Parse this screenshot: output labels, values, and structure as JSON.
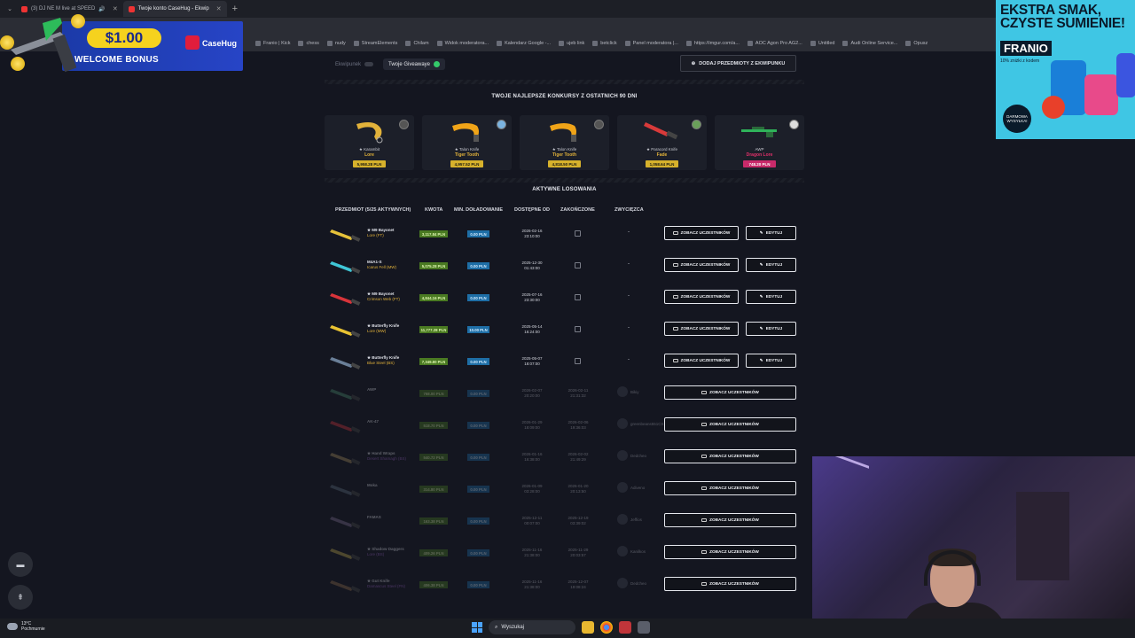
{
  "browser": {
    "tabs": [
      {
        "label": "(3) DJ NE M live at SPEED",
        "active": false
      },
      {
        "label": "Twoje konto CaseHug - Ekwip",
        "active": true
      }
    ],
    "bookmarks": [
      "Franio | Kick",
      "chess",
      "nudy",
      "StreamElements",
      "Chilam",
      "Widok moderatora...",
      "Kalendarz Google -...",
      "ujeb link",
      "betclick",
      "Panel moderatora |...",
      "https://imgur.com/a...",
      "AOC Agon Pro AG2...",
      "Untitled",
      "Audi Online Service...",
      "Opusz"
    ]
  },
  "ad_left": {
    "price": "$1.00",
    "text": "WELCOME BONUS",
    "brand": "CaseHug"
  },
  "ad_right": {
    "headline": "EKSTRA SMAK, CZYSTE SUMIENIE!",
    "brand": "FRANIO",
    "sub": "10% zniżki z kodem",
    "badge": "DARMOWA WYSYŁKA!"
  },
  "page": {
    "tab_equipment": "Ekwipunek",
    "tab_giveaways": "Twoje Giveawaye",
    "add_items_button": "DODAJ PRZEDMIOTY Z EKWIPUNKU",
    "best_title": "TWOJE NAJLEPSZE KONKURSY Z OSTATNICH 90 DNI",
    "active_title": "AKTYWNE LOSOWANIA",
    "best": [
      {
        "type": "★ Karambit",
        "name": "Lore",
        "price": "5,958.28 PLN"
      },
      {
        "type": "★ Talon Knife",
        "name": "Tiger Tooth",
        "price": "4,957.52 PLN"
      },
      {
        "type": "★ Talon Knife",
        "name": "Tiger Tooth",
        "price": "4,818.50 PLN"
      },
      {
        "type": "★ Paracord Knife",
        "name": "Fade",
        "price": "1,058.64 PLN"
      },
      {
        "type": "AWP",
        "name": "Dragon Lore",
        "price": "748.20 PLN"
      }
    ],
    "columns": [
      "PRZEDMIOT (5/25 AKTYWNYCH)",
      "KWOTA",
      "MIN. DOŁADOWANIE",
      "DOSTĘPNE OD",
      "ZAKOŃCZONE",
      "ZWYCIĘZCA"
    ],
    "see_label": "ZOBACZ UCZESTNIKÓW",
    "edit_label": "EDYTUJ",
    "rows": [
      {
        "type": "★ M9 Bayonet",
        "name": "Lore (FT)",
        "amount": "3,117.84 PLN",
        "min": "0.00 PLN",
        "from": "2026-02-16",
        "from_time": "23:10:00",
        "ended": "",
        "ended_time": "",
        "winner": "-",
        "active": true
      },
      {
        "type": "M4A1-S",
        "name": "Icarus Fell (MW)",
        "amount": "5,075.28 PLN",
        "min": "0.00 PLN",
        "from": "2025-12-30",
        "from_time": "01:43:00",
        "ended": "",
        "ended_time": "",
        "winner": "-",
        "active": true
      },
      {
        "type": "★ M9 Bayonet",
        "name": "Crimson Web (FT)",
        "amount": "4,844.16 PLN",
        "min": "0.00 PLN",
        "from": "2025-07-16",
        "from_time": "23:30:00",
        "ended": "",
        "ended_time": "",
        "winner": "-",
        "active": true
      },
      {
        "type": "★ Butterfly Knife",
        "name": "Lore (MW)",
        "amount": "11,777.28 PLN",
        "min": "10.00 PLN",
        "from": "2025-05-14",
        "from_time": "16:24:00",
        "ended": "",
        "ended_time": "",
        "winner": "-",
        "active": true
      },
      {
        "type": "★ Butterfly Knife",
        "name": "Blue Steel (BS)",
        "amount": "7,349.80 PLN",
        "min": "0.00 PLN",
        "from": "2025-05-07",
        "from_time": "18:07:00",
        "ended": "",
        "ended_time": "",
        "winner": "-",
        "active": true
      },
      {
        "type": "AWP",
        "name": "",
        "amount": "768.00 PLN",
        "min": "0.00 PLN",
        "from": "2026-02-07",
        "from_time": "20:20:00",
        "ended": "2026-02-11",
        "ended_time": "21:31:32",
        "winner": "Bikiy",
        "active": false
      },
      {
        "type": "AK-47",
        "name": "",
        "amount": "518.70 PLN",
        "min": "0.00 PLN",
        "from": "2026-01-29",
        "from_time": "18:09:00",
        "ended": "2026-02-06",
        "ended_time": "19:36:03",
        "winner": "greenbeans551CS",
        "active": false
      },
      {
        "type": "★ Hand Wraps",
        "name": "Desert Shamagh (BS)",
        "amount": "540.72 PLN",
        "min": "0.00 PLN",
        "from": "2026-01-16",
        "from_time": "16:38:00",
        "ended": "2026-02-02",
        "ended_time": "21:49:29",
        "winner": "Dedcheo",
        "active": false
      },
      {
        "type": "Moka",
        "name": "",
        "amount": "314.80 PLN",
        "min": "0.00 PLN",
        "from": "2026-01-09",
        "from_time": "03:28:00",
        "ended": "2026-01-20",
        "ended_time": "20:13:50",
        "winner": "Adiveno",
        "active": false
      },
      {
        "type": "FAMAS",
        "name": "",
        "amount": "163.38 PLN",
        "min": "0.00 PLN",
        "from": "2025-12-11",
        "from_time": "00:07:00",
        "ended": "2025-12-19",
        "ended_time": "03:39:02",
        "winner": "Jeffios",
        "active": false
      },
      {
        "type": "★ Shadow Daggers",
        "name": "Lore (BS)",
        "amount": "409.26 PLN",
        "min": "0.00 PLN",
        "from": "2025-11-16",
        "from_time": "21:38:00",
        "ended": "2025-11-29",
        "ended_time": "20:03:57",
        "winner": "Kanilkos",
        "active": false
      },
      {
        "type": "★ Gut Knife",
        "name": "Damascus Steel (FN)",
        "amount": "406.38 PLN",
        "min": "0.00 PLN",
        "from": "2025-11-16",
        "from_time": "21:38:00",
        "ended": "2025-12-07",
        "ended_time": "19:08:24",
        "winner": "Dedcheo",
        "active": false
      }
    ]
  },
  "taskbar": {
    "temp": "13°C",
    "weather": "Pochmurnie",
    "search": "Wyszukaj"
  },
  "colors": {
    "bg": "#141620",
    "amount_green": "#4a7a22",
    "min_blue": "#1e6ea6",
    "gold": "#d7b22c"
  }
}
